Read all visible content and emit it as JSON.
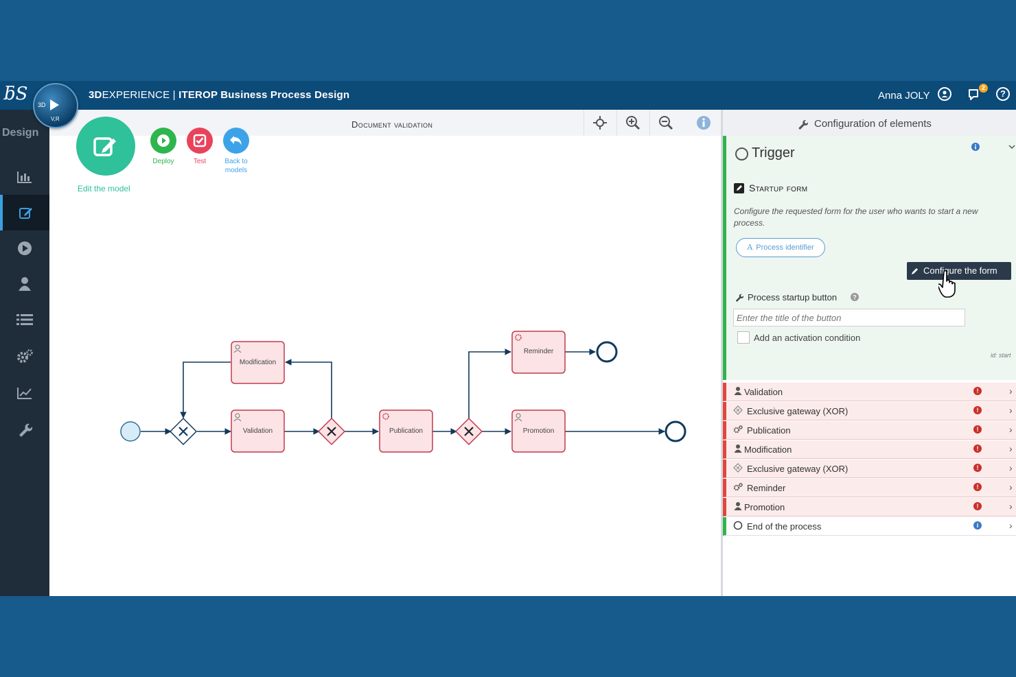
{
  "topbar": {
    "brand": "3D",
    "brand_rest": "EXPERIENCE",
    "separator": " | ",
    "app_name": "ITEROP Business Process Design",
    "user": "Anna JOLY",
    "notification_count": "2",
    "compass_3d": "3D",
    "compass_vr": "V,R"
  },
  "sidebar": {
    "brand": "Design",
    "items": [
      {
        "name": "dashboard-icon"
      },
      {
        "name": "edit-icon",
        "active": true
      },
      {
        "name": "play-icon"
      },
      {
        "name": "user-icon"
      },
      {
        "name": "list-icon"
      },
      {
        "name": "gears-icon"
      },
      {
        "name": "chart-icon"
      },
      {
        "name": "wrench-icon"
      }
    ]
  },
  "canvas": {
    "title": "Document validation",
    "edit_label": "Edit the model",
    "actions": [
      {
        "label": "Deploy",
        "color": "#2fb54e"
      },
      {
        "label": "Test",
        "color": "#e8435a"
      },
      {
        "label": "Back to models",
        "color": "#3da3e8"
      }
    ],
    "tasks": {
      "modification": "Modification",
      "validation": "Validation",
      "publication": "Publication",
      "reminder": "Reminder",
      "promotion": "Promotion"
    }
  },
  "panel": {
    "title": "Configuration of elements",
    "trigger": "Trigger",
    "startup_form": "Startup form",
    "startup_desc": "Configure the requested form for the user who wants to start a new process.",
    "process_identifier": "Process identifier",
    "configure_button": "Configure the form",
    "startup_button_label": "Process startup button",
    "startup_button_placeholder": "Enter the title of the button",
    "activation_condition": "Add an activation condition",
    "id_label": "id: start",
    "rows": [
      {
        "label": "Validation",
        "icon": "user-icon",
        "status": "error"
      },
      {
        "label": "Exclusive gateway (XOR)",
        "icon": "gateway-icon",
        "status": "error"
      },
      {
        "label": "Publication",
        "icon": "gears-icon",
        "status": "error"
      },
      {
        "label": "Modification",
        "icon": "user-icon",
        "status": "error"
      },
      {
        "label": "Exclusive gateway (XOR)",
        "icon": "gateway-icon",
        "status": "error"
      },
      {
        "label": "Reminder",
        "icon": "gears-icon",
        "status": "error"
      },
      {
        "label": "Promotion",
        "icon": "user-icon",
        "status": "error"
      },
      {
        "label": "End of the process",
        "icon": "circle-icon",
        "status": "info"
      }
    ]
  },
  "colors": {
    "accent_green": "#2fc199",
    "error_red": "#c9302c",
    "header_blue": "#0c4a78"
  }
}
